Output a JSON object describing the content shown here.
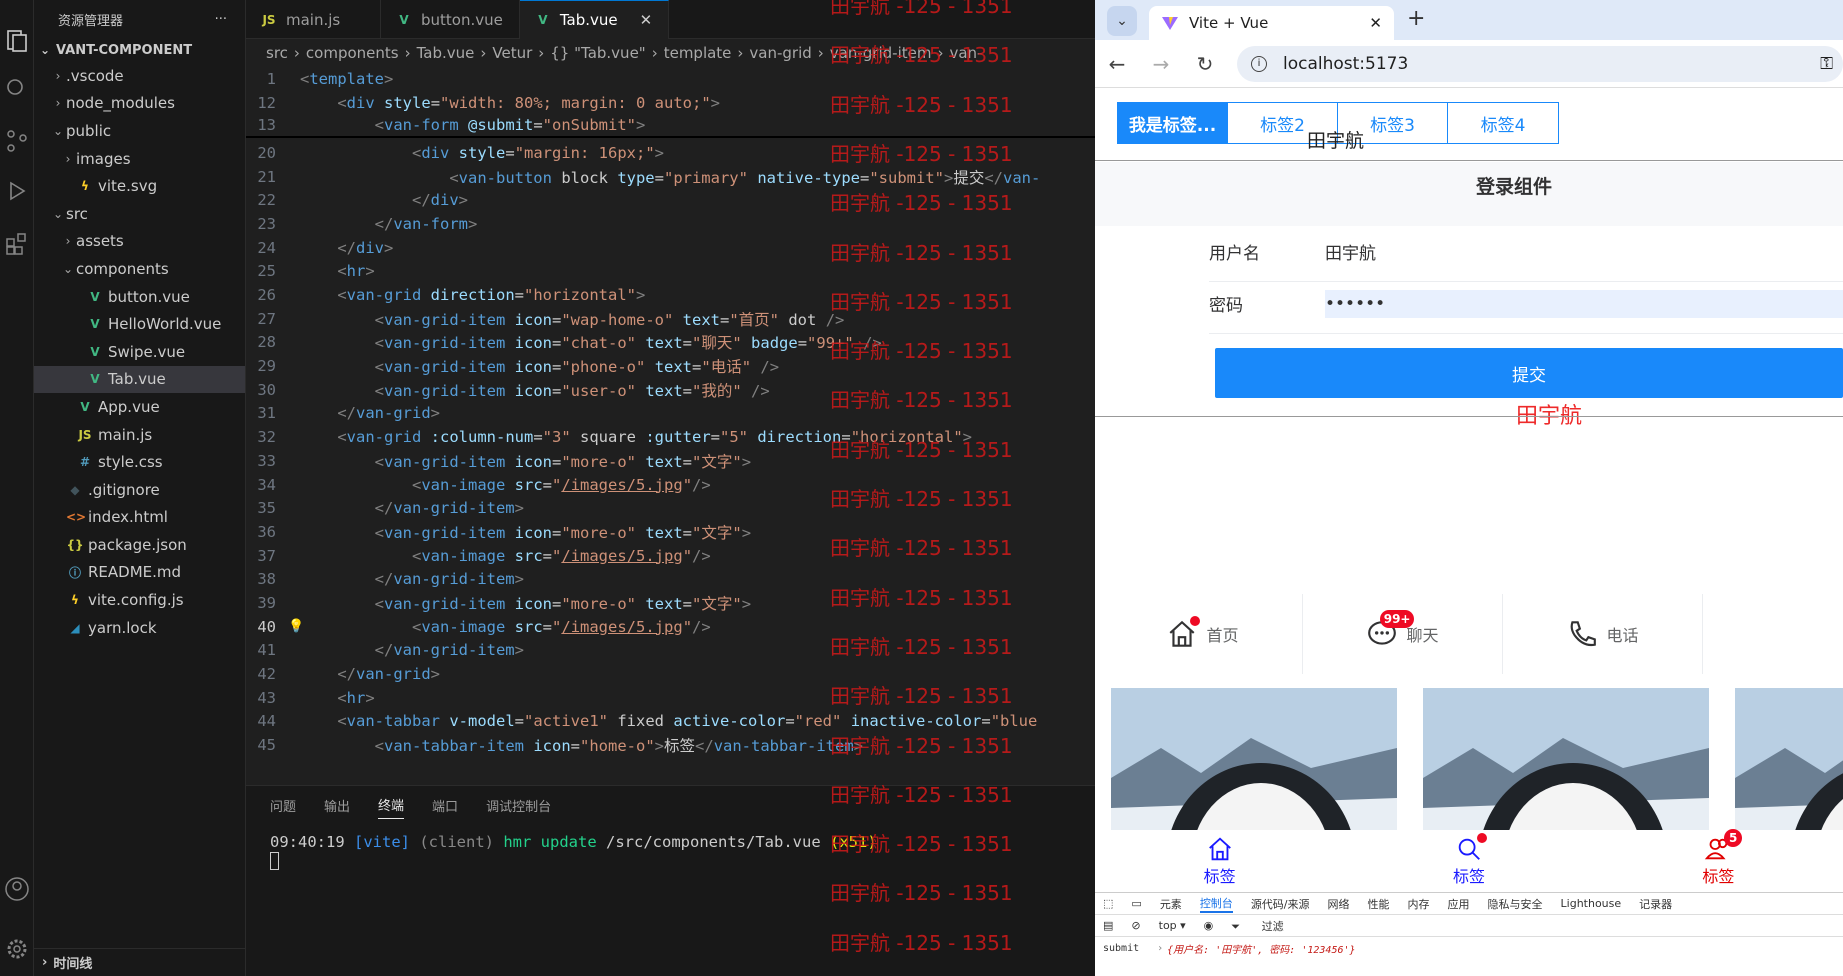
{
  "vscode": {
    "explorer_title": "资源管理器",
    "more": "···",
    "root": "VANT-COMPONENT",
    "tree": [
      {
        "label": ".vscode",
        "depth": 1,
        "kind": "folder",
        "open": false
      },
      {
        "label": "node_modules",
        "depth": 1,
        "kind": "folder",
        "open": false
      },
      {
        "label": "public",
        "depth": 1,
        "kind": "folder",
        "open": true
      },
      {
        "label": "images",
        "depth": 2,
        "kind": "folder",
        "open": false
      },
      {
        "label": "vite.svg",
        "depth": 2,
        "kind": "vite"
      },
      {
        "label": "src",
        "depth": 1,
        "kind": "folder",
        "open": true
      },
      {
        "label": "assets",
        "depth": 2,
        "kind": "folder",
        "open": false
      },
      {
        "label": "components",
        "depth": 2,
        "kind": "folder",
        "open": true
      },
      {
        "label": "button.vue",
        "depth": 3,
        "kind": "vue"
      },
      {
        "label": "HelloWorld.vue",
        "depth": 3,
        "kind": "vue"
      },
      {
        "label": "Swipe.vue",
        "depth": 3,
        "kind": "vue"
      },
      {
        "label": "Tab.vue",
        "depth": 3,
        "kind": "vue",
        "selected": true
      },
      {
        "label": "App.vue",
        "depth": 2,
        "kind": "vue"
      },
      {
        "label": "main.js",
        "depth": 2,
        "kind": "js"
      },
      {
        "label": "style.css",
        "depth": 2,
        "kind": "css"
      },
      {
        "label": ".gitignore",
        "depth": 1,
        "kind": "git"
      },
      {
        "label": "index.html",
        "depth": 1,
        "kind": "html"
      },
      {
        "label": "package.json",
        "depth": 1,
        "kind": "json"
      },
      {
        "label": "README.md",
        "depth": 1,
        "kind": "info"
      },
      {
        "label": "vite.config.js",
        "depth": 1,
        "kind": "vite"
      },
      {
        "label": "yarn.lock",
        "depth": 1,
        "kind": "yarn"
      }
    ],
    "timeline": "时间线",
    "tabs": [
      {
        "label": "main.js",
        "icon": "JS"
      },
      {
        "label": "button.vue",
        "icon": "V"
      },
      {
        "label": "Tab.vue",
        "icon": "V",
        "active": true
      }
    ],
    "breadcrumb": [
      "src",
      "components",
      "Tab.vue",
      "Vetur",
      "{} \"Tab.vue\"",
      "template",
      "van-grid",
      "van-grid-item",
      "van-"
    ],
    "code_lines": [
      {
        "n": "1",
        "t": "<template>",
        "sticky": true
      },
      {
        "n": "12",
        "t": "    <div style=\"width: 80%; margin: 0 auto;\">",
        "sticky": true
      },
      {
        "n": "13",
        "t": "        <van-form @submit=\"onSubmit\">",
        "sticky": true
      },
      {
        "n": "20",
        "t": "            <div style=\"margin: 16px;\">"
      },
      {
        "n": "21",
        "t": "                <van-button block type=\"primary\" native-type=\"submit\">提交</van-"
      },
      {
        "n": "22",
        "t": "            </div>"
      },
      {
        "n": "23",
        "t": "        </van-form>"
      },
      {
        "n": "24",
        "t": "    </div>"
      },
      {
        "n": "25",
        "t": "    <hr>"
      },
      {
        "n": "26",
        "t": "    <van-grid direction=\"horizontal\">"
      },
      {
        "n": "27",
        "t": "        <van-grid-item icon=\"wap-home-o\" text=\"首页\" dot />"
      },
      {
        "n": "28",
        "t": "        <van-grid-item icon=\"chat-o\" text=\"聊天\" badge=\"99+\" />"
      },
      {
        "n": "29",
        "t": "        <van-grid-item icon=\"phone-o\" text=\"电话\" />"
      },
      {
        "n": "30",
        "t": "        <van-grid-item icon=\"user-o\" text=\"我的\" />"
      },
      {
        "n": "31",
        "t": "    </van-grid>"
      },
      {
        "n": "32",
        "t": "    <van-grid :column-num=\"3\" square :gutter=\"5\" direction=\"horizontal\">"
      },
      {
        "n": "33",
        "t": "        <van-grid-item icon=\"more-o\" text=\"文字\">"
      },
      {
        "n": "34",
        "t": "            <van-image src=\"/images/5.jpg\"/>"
      },
      {
        "n": "35",
        "t": "        </van-grid-item>"
      },
      {
        "n": "36",
        "t": "        <van-grid-item icon=\"more-o\" text=\"文字\">"
      },
      {
        "n": "37",
        "t": "            <van-image src=\"/images/5.jpg\"/>"
      },
      {
        "n": "38",
        "t": "        </van-grid-item>"
      },
      {
        "n": "39",
        "t": "        <van-grid-item icon=\"more-o\" text=\"文字\">"
      },
      {
        "n": "40",
        "t": "            <van-image src=\"/images/5.jpg\"/>",
        "current": true
      },
      {
        "n": "41",
        "t": "        </van-grid-item>"
      },
      {
        "n": "42",
        "t": "    </van-grid>"
      },
      {
        "n": "43",
        "t": "    <hr>"
      },
      {
        "n": "44",
        "t": "    <van-tabbar v-model=\"active1\" fixed active-color=\"red\" inactive-color=\"blue"
      },
      {
        "n": "45",
        "t": "        <van-tabbar-item icon=\"home-o\">标签</van-tabbar-item>"
      }
    ],
    "panel_tabs": [
      "问题",
      "输出",
      "终端",
      "端口",
      "调试控制台"
    ],
    "panel_active": "终端",
    "terminal": {
      "time": "09:40:19",
      "tag": "[vite]",
      "client": "(client)",
      "msg": "hmr update",
      "path": "/src/components/Tab.vue",
      "count": "(x51)"
    },
    "watermark": "田宇航 -125 - 1351"
  },
  "browser": {
    "tab_title": "Vite + Vue",
    "url": "localhost:5173",
    "vtabs": [
      "我是标签...",
      "标签2",
      "标签3",
      "标签4"
    ],
    "name_text": "田宇航",
    "form_title": "登录组件",
    "username_label": "用户名",
    "username_value": "田宇航",
    "password_label": "密码",
    "password_value": "••••••",
    "submit_label": "提交",
    "red_name": "田宇航",
    "grid": [
      {
        "label": "首页",
        "icon": "home-icon",
        "dot": true
      },
      {
        "label": "聊天",
        "icon": "chat-icon",
        "badge": "99+"
      },
      {
        "label": "电话",
        "icon": "phone-icon"
      }
    ],
    "tabbar": [
      {
        "label": "标签",
        "icon": "home-icon",
        "color": "#1a1aff"
      },
      {
        "label": "标签",
        "icon": "search-icon",
        "color": "#1a1aff",
        "dot": true
      },
      {
        "label": "标签",
        "icon": "friends-icon",
        "color": "#e00000",
        "badge": "5"
      }
    ],
    "devtools_tabs": [
      "元素",
      "控制台",
      "源代码/来源",
      "网络",
      "性能",
      "内存",
      "应用",
      "隐私与安全",
      "Lighthouse",
      "记录器"
    ],
    "devtools_active": "控制台",
    "context": "top ▾",
    "filter": "过滤",
    "log_label": "submit",
    "log_text": "{用户名: '田宇航', 密码: '123456'}"
  },
  "colors": {
    "vant_blue": "#1989fa",
    "red": "#ee0a24"
  }
}
